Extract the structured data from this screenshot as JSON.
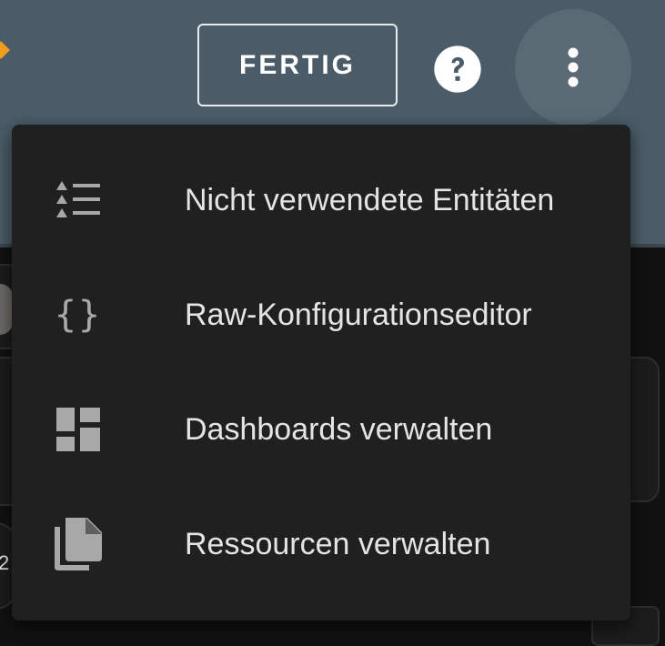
{
  "toolbar": {
    "done_label": "FERTIG",
    "help_icon": "help-circle-icon",
    "more_icon": "more-vertical-icon"
  },
  "menu": {
    "items": [
      {
        "label": "Nicht verwendete Entitäten",
        "icon": "format-list-checks-icon"
      },
      {
        "label": "Raw-Konfigurationseditor",
        "icon": "code-braces-icon"
      },
      {
        "label": "Dashboards verwalten",
        "icon": "view-dashboard-icon"
      },
      {
        "label": "Ressourcen verwalten",
        "icon": "file-multiple-icon"
      }
    ]
  },
  "background": {
    "partial_number": "2"
  },
  "colors": {
    "toolbar": "#4b5c68",
    "menu": "#202020",
    "text": "#e4e4e4",
    "icon": "#a8a8a8",
    "accent": "#f29c1f"
  }
}
